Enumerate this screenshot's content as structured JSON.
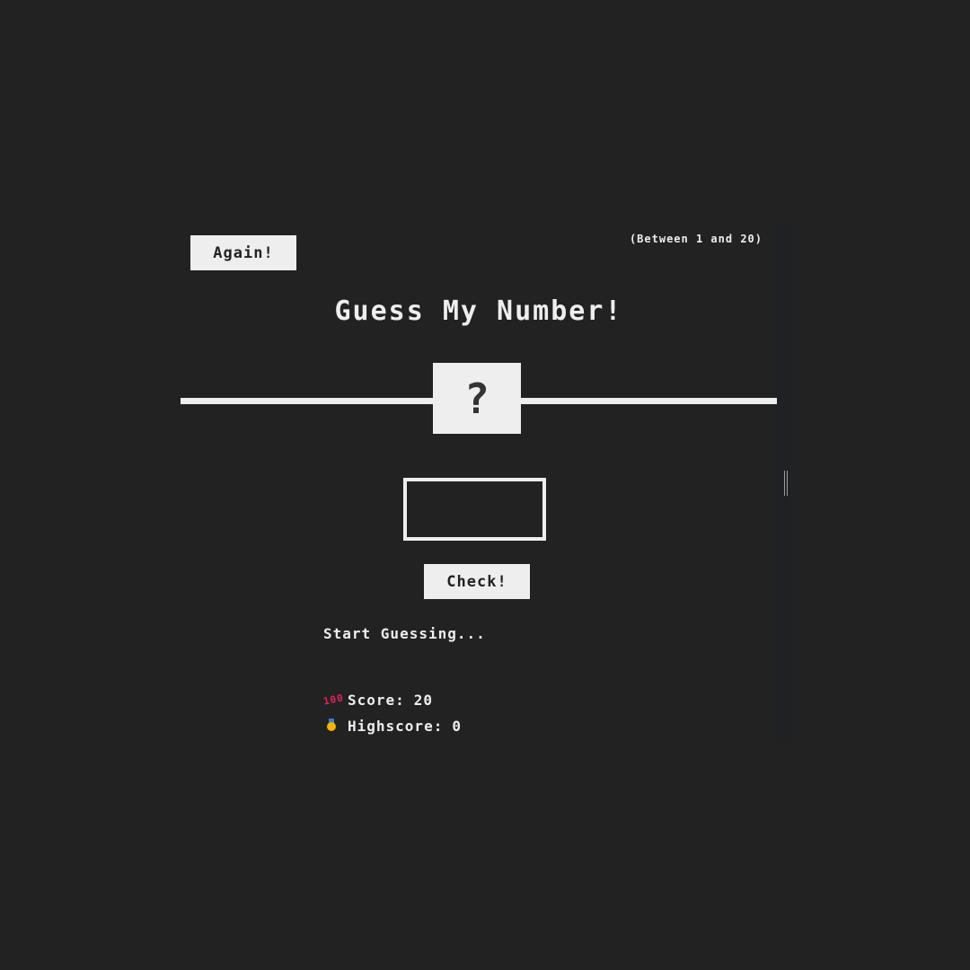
{
  "header": {
    "again_label": "Again!",
    "range_hint": "(Between 1 and 20)"
  },
  "title": "Guess My Number!",
  "secret_display": "?",
  "guess_input": {
    "value": "",
    "placeholder": ""
  },
  "check_label": "Check!",
  "message": "Start Guessing...",
  "stats": {
    "score_label": "Score:",
    "score_value": "20",
    "score_icon": "hundred-points-emoji",
    "highscore_label": "Highscore:",
    "highscore_value": "0",
    "highscore_icon": "medal-emoji"
  },
  "colors": {
    "background": "#222222",
    "foreground": "#eeeeee",
    "scrollbar": "#202124"
  }
}
